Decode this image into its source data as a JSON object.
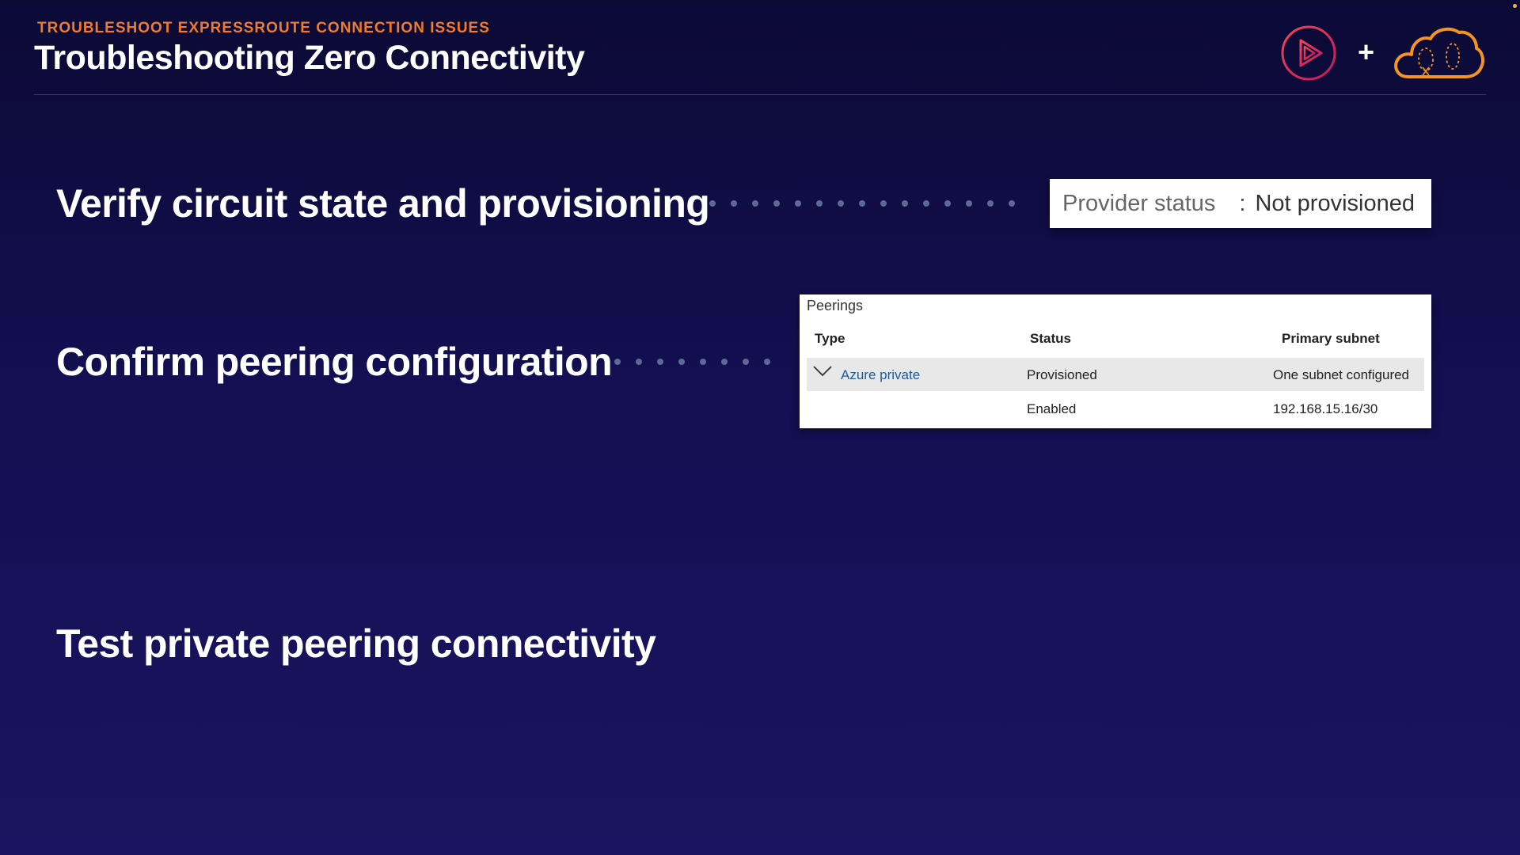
{
  "header": {
    "eyebrow": "TROUBLESHOOT EXPRESSROUTE CONNECTION ISSUES",
    "title": "Troubleshooting Zero Connectivity",
    "plus": "+"
  },
  "steps": [
    "Verify circuit state and provisioning",
    "Confirm peering configuration",
    "Test private peering connectivity"
  ],
  "provider_status": {
    "label": "Provider status",
    "separator": ":",
    "value": "Not provisioned"
  },
  "peerings": {
    "title": "Peerings",
    "columns": [
      "Type",
      "Status",
      "Primary subnet"
    ],
    "rows": [
      {
        "type": "Azure private",
        "status": "Provisioned",
        "subnet": "One subnet configured"
      },
      {
        "type": "",
        "status": "Enabled",
        "subnet": "192.168.15.16/30"
      }
    ]
  },
  "icons": {
    "play": "pluralsight-play-icon",
    "cloud": "acloudguru-cloud-icon",
    "chevron": "chevron-down-icon"
  },
  "colors": {
    "accent_orange": "#f27b2a",
    "play_red": "#e0245e",
    "link_blue": "#1a5a9a",
    "background": "#130f52"
  }
}
